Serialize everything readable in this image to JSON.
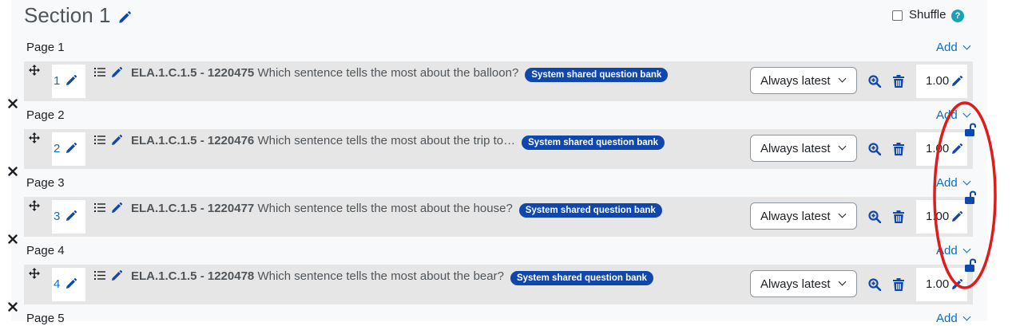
{
  "section": {
    "title": "Section 1"
  },
  "shuffle": {
    "label": "Shuffle",
    "checked": false,
    "help": "?"
  },
  "add_label": "Add",
  "pages": [
    {
      "label": "Page 1",
      "slot": {
        "number": "1",
        "code": "ELA.1.C.1.5 - 1220475",
        "question": "Which sentence tells the most about the balloon?",
        "bank": "System shared question bank",
        "version": "Always latest",
        "mark": "1.00",
        "lock": false
      }
    },
    {
      "label": "Page 2",
      "slot": {
        "number": "2",
        "code": "ELA.1.C.1.5 - 1220476",
        "question": "Which sentence tells the most about the trip to…",
        "bank": "System shared question bank",
        "version": "Always latest",
        "mark": "1.00",
        "lock": true
      }
    },
    {
      "label": "Page 3",
      "slot": {
        "number": "3",
        "code": "ELA.1.C.1.5 - 1220477",
        "question": "Which sentence tells the most about the house?",
        "bank": "System shared question bank",
        "version": "Always latest",
        "mark": "1.00",
        "lock": true
      }
    },
    {
      "label": "Page 4",
      "slot": {
        "number": "4",
        "code": "ELA.1.C.1.5 - 1220478",
        "question": "Which sentence tells the most about the bear?",
        "bank": "System shared question bank",
        "version": "Always latest",
        "mark": "1.00",
        "lock": true
      }
    },
    {
      "label": "Page 5"
    }
  ],
  "colors": {
    "link": "#0f6cbf",
    "badge": "#0f47ad",
    "row": "#e6e6e6",
    "annotation": "#e01b1b",
    "help": "#17a2b8"
  },
  "icons": [
    "edit-pencil-icon",
    "move-icon",
    "list-icon",
    "preview-icon",
    "trash-icon",
    "remove-page-break-icon",
    "unlock-icon",
    "help-icon"
  ]
}
